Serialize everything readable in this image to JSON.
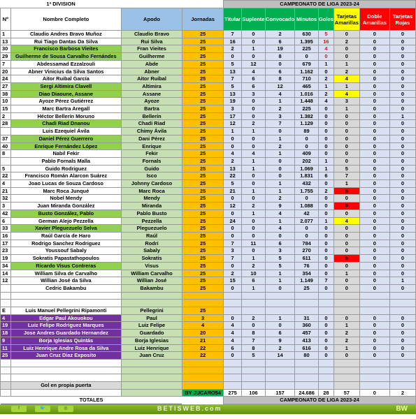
{
  "header": {
    "division": "1ª DIVISION",
    "competition": "CAMPEONATO  DE LIGA 2023-24",
    "columns": [
      "Nº",
      "Nombre Completo",
      "Apodo",
      "Jornadas",
      "Titular",
      "Suplente",
      "Convocado",
      "Minutos",
      "Goles",
      "Tarjetas Amarillas",
      "Doble Amarillas",
      "Tarjetas Rojas"
    ]
  },
  "colors": {
    "green_row": "#92d050",
    "purple_row": "#7030a0",
    "yellow_card": "#ffff00",
    "red_card": "#ff0000",
    "jornadas": "#ffc000"
  },
  "rows": [
    [
      "1",
      "Claudio Andres Bravo Muñoz",
      "Claudio Bravo",
      "25",
      "7",
      "0",
      "2",
      "630",
      "5",
      "0",
      "0",
      "0",
      "white",
      "",
      "gk"
    ],
    [
      "13",
      "Rui Tiago Dantas Da Silva",
      "Rui Silva",
      "25",
      "16",
      "0",
      "6",
      "1.395",
      "16",
      "2",
      "0",
      "0",
      "white",
      "",
      "gk"
    ],
    [
      "30",
      "Francisco Barbosa Vieites",
      "Fran Vieites",
      "25",
      "2",
      "1",
      "19",
      "225",
      "4",
      "0",
      "0",
      "0",
      "green",
      "",
      "gk"
    ],
    [
      "29",
      "Guilherme de Sousa Carvalho Fernándes",
      "Guilherme",
      "25",
      "0",
      "0",
      "8",
      "0",
      "0",
      "0",
      "0",
      "0",
      "green",
      "",
      "gk"
    ],
    [
      "7",
      "Abdessamad Ezzalzouli",
      "Abde",
      "25",
      "5",
      "12",
      "0",
      "679",
      "1",
      "1",
      "0",
      "0",
      "white",
      "",
      ""
    ],
    [
      "20",
      "Abner Vinicius da Silva Santos",
      "Abner",
      "25",
      "13",
      "4",
      "6",
      "1.162",
      "0",
      "2",
      "0",
      "0",
      "white",
      "",
      ""
    ],
    [
      "24",
      "Aitor Ruibal García",
      "Aitor Ruibal",
      "25",
      "7",
      "6",
      "8",
      "710",
      "2",
      "4",
      "0",
      "0",
      "white",
      "yellow",
      ""
    ],
    [
      "27",
      "Sergi Altimira Clavell",
      "Altimira",
      "25",
      "5",
      "6",
      "12",
      "465",
      "1",
      "1",
      "0",
      "0",
      "green",
      "",
      ""
    ],
    [
      "38",
      "Diao Diaoune, Assane",
      "Assane",
      "25",
      "13",
      "3",
      "4",
      "1.016",
      "2",
      "4",
      "0",
      "0",
      "green",
      "yellow",
      ""
    ],
    [
      "10",
      "Ayoze Pérez Gutiérrez",
      "Ayoze",
      "25",
      "19",
      "0",
      "1",
      "1.448",
      "4",
      "3",
      "0",
      "0",
      "white",
      "",
      ""
    ],
    [
      "15",
      "Marc Bartra Aregall",
      "Bartra",
      "25",
      "3",
      "0",
      "2",
      "225",
      "0",
      "1",
      "0",
      "0",
      "white",
      "",
      ""
    ],
    [
      "2",
      "Héctor Bellerín Moruno",
      "Bellerín",
      "25",
      "17",
      "0",
      "3",
      "1.382",
      "0",
      "0",
      "0",
      "1",
      "white",
      "",
      ""
    ],
    [
      "28",
      "Chadi Riad Dnanou",
      "Chadi Riad",
      "25",
      "12",
      "2",
      "7",
      "1.129",
      "0",
      "0",
      "0",
      "0",
      "green",
      "",
      ""
    ],
    [
      "",
      "Luis Ezequiel Ávila",
      "Chimy Ávila",
      "25",
      "1",
      "1",
      "0",
      "89",
      "0",
      "0",
      "0",
      "0",
      "white",
      "",
      ""
    ],
    [
      "37",
      "Daniel Pérez Guerrero",
      "Dani Pérez",
      "25",
      "0",
      "0",
      "1",
      "0",
      "0",
      "0",
      "0",
      "0",
      "green",
      "",
      ""
    ],
    [
      "40",
      "Enrique Fernández López",
      "Enrique",
      "25",
      "0",
      "0",
      "2",
      "0",
      "0",
      "0",
      "0",
      "0",
      "green",
      "",
      ""
    ],
    [
      "8",
      "Nabil Fekir",
      "Fekir",
      "25",
      "4",
      "4",
      "1",
      "409",
      "0",
      "0",
      "0",
      "0",
      "white",
      "",
      ""
    ],
    [
      "",
      "Pablo Fornals Malla",
      "Fornals",
      "25",
      "2",
      "1",
      "0",
      "202",
      "1",
      "0",
      "0",
      "0",
      "white",
      "",
      ""
    ],
    [
      "5",
      "Guido Rodriguez",
      "Guido",
      "25",
      "13",
      "1",
      "0",
      "1.069",
      "1",
      "5",
      "0",
      "0",
      "white",
      "",
      ""
    ],
    [
      "22",
      "Francisco Román Alarcon Suárez",
      "Isco",
      "25",
      "22",
      "0",
      "0",
      "1.831",
      "6",
      "7",
      "0",
      "0",
      "white",
      "",
      ""
    ],
    [
      "4",
      "Joao Lucas de Souza Cardoso",
      "Johnny Cardoso",
      "25",
      "5",
      "0",
      "1",
      "432",
      "0",
      "1",
      "0",
      "0",
      "white",
      "",
      ""
    ],
    [
      "21",
      "Marc Roca Junqué",
      "Marc Roca",
      "25",
      "21",
      "1",
      "1",
      "1.755",
      "2",
      "5",
      "0",
      "0",
      "white",
      "red",
      ""
    ],
    [
      "32",
      "Nobel Mendy",
      "Mendy",
      "25",
      "0",
      "0",
      "2",
      "0",
      "0",
      "0",
      "0",
      "0",
      "white",
      "",
      ""
    ],
    [
      "3",
      "Juan Miranda González",
      "Miranda",
      "25",
      "12",
      "2",
      "9",
      "1.088",
      "0",
      "5",
      "0",
      "0",
      "white",
      "red",
      ""
    ],
    [
      "42",
      "Busto González, Pablo",
      "Pablo Busto",
      "25",
      "0",
      "1",
      "4",
      "42",
      "0",
      "0",
      "0",
      "0",
      "green",
      "",
      ""
    ],
    [
      "6",
      "German Alejo Pezzella",
      "Pezzella",
      "25",
      "24",
      "0",
      "1",
      "2.077",
      "1",
      "4",
      "0",
      "0",
      "white",
      "yellow",
      ""
    ],
    [
      "33",
      "Xavier Pleguezuelo Selva",
      "Pleguezuelo",
      "25",
      "0",
      "0",
      "4",
      "0",
      "0",
      "0",
      "0",
      "0",
      "green",
      "",
      ""
    ],
    [
      "16",
      "Raúl García de Haro",
      "Raúl",
      "25",
      "0",
      "0",
      "0",
      "0",
      "0",
      "0",
      "0",
      "0",
      "white",
      "",
      ""
    ],
    [
      "17",
      "Rodrigo Sanchez Rodriguez",
      "Rodri",
      "25",
      "7",
      "11",
      "6",
      "784",
      "0",
      "0",
      "0",
      "0",
      "white",
      "",
      ""
    ],
    [
      "23",
      "Youssouf Sabaly",
      "Sabaly",
      "25",
      "3",
      "0",
      "3",
      "270",
      "0",
      "0",
      "0",
      "0",
      "white",
      "",
      ""
    ],
    [
      "19",
      "Sokratis Papastathopoulos",
      "Sokratis",
      "25",
      "7",
      "1",
      "5",
      "611",
      "0",
      "5",
      "0",
      "0",
      "white",
      "red",
      ""
    ],
    [
      "34",
      "Ricardo Visus Contreras",
      "Visus",
      "25",
      "0",
      "2",
      "5",
      "76",
      "0",
      "0",
      "0",
      "0",
      "green",
      "",
      ""
    ],
    [
      "14",
      "William Silva de Carvalho",
      "William Carvalho",
      "25",
      "2",
      "10",
      "1",
      "354",
      "0",
      "1",
      "0",
      "0",
      "white",
      "",
      ""
    ],
    [
      "12",
      "Willian José da Silva",
      "Willian José",
      "25",
      "15",
      "6",
      "1",
      "1.149",
      "7",
      "0",
      "0",
      "1",
      "white",
      "",
      ""
    ],
    [
      "",
      "Cedric Bakambu",
      "Bakambu",
      "25",
      "0",
      "1",
      "0",
      "25",
      "0",
      "0",
      "0",
      "0",
      "white",
      "",
      ""
    ],
    [
      "",
      "",
      "",
      "",
      "",
      "",
      "",
      "",
      "",
      "",
      "",
      "",
      "white",
      "",
      ""
    ],
    [
      "",
      "",
      "",
      "",
      "",
      "",
      "",
      "",
      "",
      "",
      "",
      "",
      "white",
      "",
      ""
    ],
    [
      "E",
      "Luis Manuel Pellegrini Ripamonti",
      "Pellegrini",
      "25",
      "",
      "",
      "",
      "",
      "",
      "",
      "",
      "",
      "white",
      "",
      ""
    ],
    [
      "4",
      "Edgar Paul Akouokou",
      "Paul",
      "3",
      "0",
      "2",
      "1",
      "31",
      "0",
      "0",
      "0",
      "0",
      "purple",
      "",
      ""
    ],
    [
      "19",
      "Luiz Felipe Rodriguez Marques",
      "Luiz Felipe",
      "4",
      "4",
      "0",
      "0",
      "360",
      "0",
      "1",
      "0",
      "0",
      "purple",
      "",
      ""
    ],
    [
      "18",
      "Jose Andres Guardado Hernandez",
      "Guardado",
      "20",
      "4",
      "8",
      "6",
      "457",
      "0",
      "2",
      "0",
      "0",
      "purple",
      "",
      ""
    ],
    [
      "9",
      "Borja Iglesias Quintás",
      "Borja Iglesias",
      "21",
      "4",
      "7",
      "9",
      "413",
      "0",
      "2",
      "0",
      "0",
      "purple",
      "",
      ""
    ],
    [
      "11",
      "Luiz Henrique Andre Rosa da Silva",
      "Luiz Henrique",
      "22",
      "6",
      "8",
      "2",
      "616",
      "0",
      "1",
      "0",
      "0",
      "purple",
      "",
      ""
    ],
    [
      "25",
      "Juan Cruz Diaz Exposito",
      "Juan Cruz",
      "22",
      "0",
      "5",
      "14",
      "80",
      "0",
      "0",
      "0",
      "0",
      "purple",
      "",
      ""
    ],
    [
      "",
      "",
      "",
      "",
      "",
      "",
      "",
      "",
      "",
      "",
      "",
      "",
      "white",
      "",
      ""
    ],
    [
      "",
      "",
      "",
      "",
      "",
      "",
      "",
      "",
      "",
      "",
      "",
      "",
      "white",
      "",
      ""
    ],
    [
      "",
      "",
      "",
      "",
      "",
      "",
      "",
      "",
      "",
      "",
      "",
      "",
      "white",
      "",
      ""
    ],
    [
      "",
      "Gol en propia puerta",
      "",
      "",
      "",
      "",
      "",
      "",
      "",
      "",
      "",
      "",
      "white",
      "",
      ""
    ]
  ],
  "totals": {
    "credit": "BY JUCARO54",
    "values": [
      "275",
      "106",
      "157",
      "24.686",
      "28",
      "57",
      "0",
      "2"
    ],
    "label": "TOTALES",
    "competition": "CAMPEONATO  DE LIGA 2023-24"
  },
  "footer": {
    "brand": "BETISWEB.com",
    "logo": "BW",
    "social": [
      "facebook-icon",
      "twitter-icon",
      "instagram-icon"
    ]
  }
}
